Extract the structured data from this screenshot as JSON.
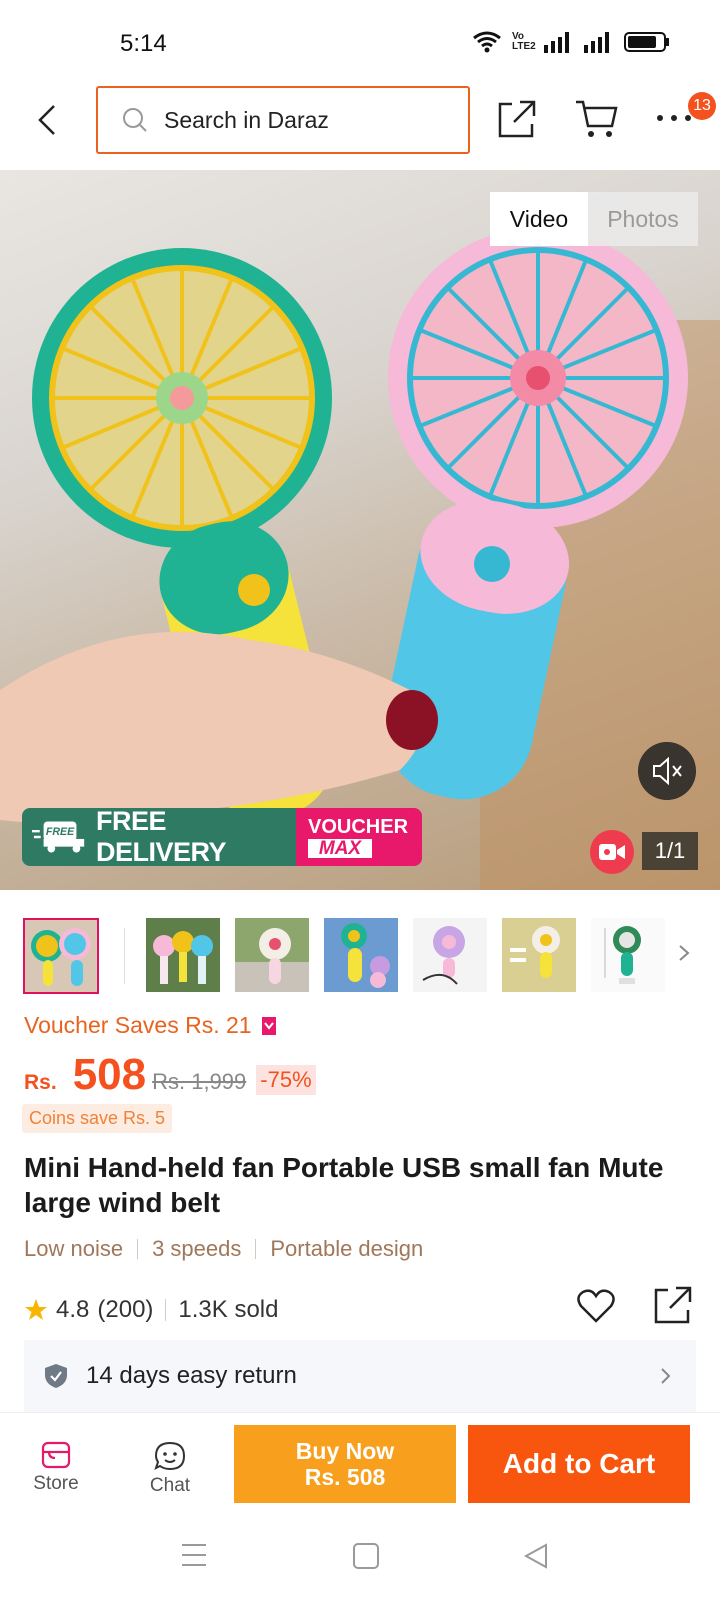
{
  "status_bar": {
    "time": "5:14",
    "icons": [
      "wifi-icon",
      "volte-icon",
      "signal-icon",
      "signal-icon",
      "battery-icon"
    ],
    "volte_label": "Vo LTE2"
  },
  "header": {
    "search_placeholder": "Search in Daraz",
    "notification_count": "13",
    "accent_color": "#e9631e"
  },
  "media": {
    "tabs": [
      {
        "label": "Video",
        "active": true
      },
      {
        "label": "Photos",
        "active": false
      }
    ],
    "counter": "1/1",
    "promo": {
      "free_tag": "FREE",
      "free_text": "FREE DELIVERY",
      "voucher_line1": "VOUCHER",
      "voucher_line2": "MAX"
    }
  },
  "thumbnails": {
    "count": 7,
    "selected_index": 0
  },
  "product": {
    "voucher_saves": "Voucher Saves Rs. 21",
    "currency": "Rs.",
    "price": "508",
    "original_price": "Rs. 1,999",
    "discount": "-75%",
    "coins": "Coins save Rs. 5",
    "title": "Mini Hand-held fan Portable USB small fan Mute large wind belt",
    "features": [
      "Low noise",
      "3 speeds",
      "Portable design"
    ],
    "rating": "4.8",
    "review_count": "(200)",
    "sold": "1.3K sold",
    "return_policy": "14 days easy return",
    "price_color": "#f4511e"
  },
  "actions": {
    "store_label": "Store",
    "chat_label": "Chat",
    "buy_now_line1": "Buy Now",
    "buy_now_line2": "Rs. 508",
    "add_to_cart": "Add to Cart",
    "buy_color": "#f8a01e",
    "cart_color": "#f8550f"
  }
}
